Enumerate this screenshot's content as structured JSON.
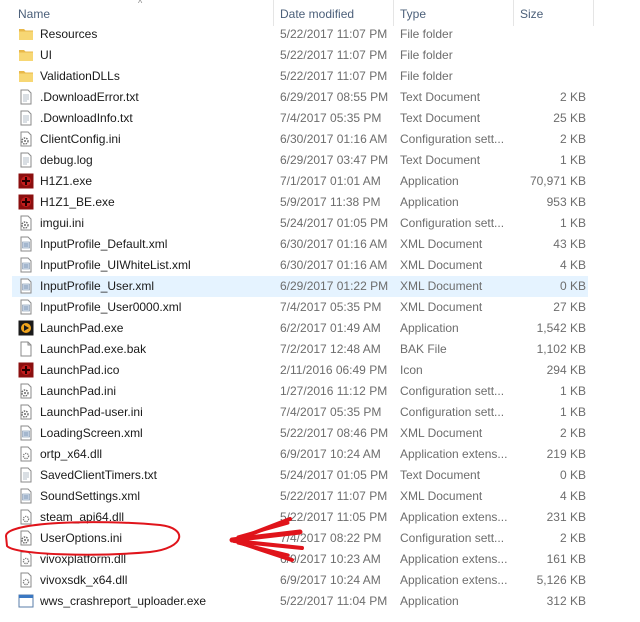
{
  "columns": {
    "name": "Name",
    "date_modified": "Date modified",
    "type": "Type",
    "size": "Size"
  },
  "sort_indicator": "^",
  "files": [
    {
      "name": "Resources",
      "date": "5/22/2017 11:07 PM",
      "type": "File folder",
      "size": "",
      "icon": "folder-icon"
    },
    {
      "name": "UI",
      "date": "5/22/2017 11:07 PM",
      "type": "File folder",
      "size": "",
      "icon": "folder-icon"
    },
    {
      "name": "ValidationDLLs",
      "date": "5/22/2017 11:07 PM",
      "type": "File folder",
      "size": "",
      "icon": "folder-icon"
    },
    {
      "name": ".DownloadError.txt",
      "date": "6/29/2017 08:55 PM",
      "type": "Text Document",
      "size": "2 KB",
      "icon": "text-file-icon"
    },
    {
      "name": ".DownloadInfo.txt",
      "date": "7/4/2017 05:35 PM",
      "type": "Text Document",
      "size": "25 KB",
      "icon": "text-file-icon"
    },
    {
      "name": "ClientConfig.ini",
      "date": "6/30/2017 01:16 AM",
      "type": "Configuration sett...",
      "size": "2 KB",
      "icon": "config-file-icon"
    },
    {
      "name": "debug.log",
      "date": "6/29/2017 03:47 PM",
      "type": "Text Document",
      "size": "1 KB",
      "icon": "text-file-icon"
    },
    {
      "name": "H1Z1.exe",
      "date": "7/1/2017 01:01 AM",
      "type": "Application",
      "size": "70,971 KB",
      "icon": "h1z1-app-icon"
    },
    {
      "name": "H1Z1_BE.exe",
      "date": "5/9/2017 11:38 PM",
      "type": "Application",
      "size": "953 KB",
      "icon": "h1z1-app-icon"
    },
    {
      "name": "imgui.ini",
      "date": "5/24/2017 01:05 PM",
      "type": "Configuration sett...",
      "size": "1 KB",
      "icon": "config-file-icon"
    },
    {
      "name": "InputProfile_Default.xml",
      "date": "6/30/2017 01:16 AM",
      "type": "XML Document",
      "size": "43 KB",
      "icon": "xml-file-icon"
    },
    {
      "name": "InputProfile_UIWhiteList.xml",
      "date": "6/30/2017 01:16 AM",
      "type": "XML Document",
      "size": "4 KB",
      "icon": "xml-file-icon"
    },
    {
      "name": "InputProfile_User.xml",
      "date": "6/29/2017 01:22 PM",
      "type": "XML Document",
      "size": "0 KB",
      "icon": "xml-file-icon",
      "selected": true
    },
    {
      "name": "InputProfile_User0000.xml",
      "date": "7/4/2017 05:35 PM",
      "type": "XML Document",
      "size": "27 KB",
      "icon": "xml-file-icon"
    },
    {
      "name": "LaunchPad.exe",
      "date": "6/2/2017 01:49 AM",
      "type": "Application",
      "size": "1,542 KB",
      "icon": "launchpad-app-icon"
    },
    {
      "name": "LaunchPad.exe.bak",
      "date": "7/2/2017 12:48 AM",
      "type": "BAK File",
      "size": "1,102 KB",
      "icon": "blank-file-icon"
    },
    {
      "name": "LaunchPad.ico",
      "date": "2/11/2016 06:49 PM",
      "type": "Icon",
      "size": "294 KB",
      "icon": "h1z1-app-icon"
    },
    {
      "name": "LaunchPad.ini",
      "date": "1/27/2016 11:12 PM",
      "type": "Configuration sett...",
      "size": "1 KB",
      "icon": "config-file-icon"
    },
    {
      "name": "LaunchPad-user.ini",
      "date": "7/4/2017 05:35 PM",
      "type": "Configuration sett...",
      "size": "1 KB",
      "icon": "config-file-icon"
    },
    {
      "name": "LoadingScreen.xml",
      "date": "5/22/2017 08:46 PM",
      "type": "XML Document",
      "size": "2 KB",
      "icon": "xml-file-icon"
    },
    {
      "name": "ortp_x64.dll",
      "date": "6/9/2017 10:24 AM",
      "type": "Application extens...",
      "size": "219 KB",
      "icon": "dll-file-icon"
    },
    {
      "name": "SavedClientTimers.txt",
      "date": "5/24/2017 01:05 PM",
      "type": "Text Document",
      "size": "0 KB",
      "icon": "text-file-icon"
    },
    {
      "name": "SoundSettings.xml",
      "date": "5/22/2017 11:07 PM",
      "type": "XML Document",
      "size": "4 KB",
      "icon": "xml-file-icon"
    },
    {
      "name": "steam_api64.dll",
      "date": "5/22/2017 11:05 PM",
      "type": "Application extens...",
      "size": "231 KB",
      "icon": "dll-file-icon"
    },
    {
      "name": "UserOptions.ini",
      "date": "7/4/2017 08:22 PM",
      "type": "Configuration sett...",
      "size": "2 KB",
      "icon": "config-file-icon",
      "annotated": true
    },
    {
      "name": "vivoxplatform.dll",
      "date": "6/9/2017 10:23 AM",
      "type": "Application extens...",
      "size": "161 KB",
      "icon": "dll-file-icon"
    },
    {
      "name": "vivoxsdk_x64.dll",
      "date": "6/9/2017 10:24 AM",
      "type": "Application extens...",
      "size": "5,126 KB",
      "icon": "dll-file-icon"
    },
    {
      "name": "wws_crashreport_uploader.exe",
      "date": "5/22/2017 11:04 PM",
      "type": "Application",
      "size": "312 KB",
      "icon": "exe-window-icon"
    }
  ],
  "colors": {
    "header_text": "#4c607a",
    "selected_row": "#e5f3ff",
    "annotation_red": "#e0141b",
    "folder_yellow": "#f7d774"
  }
}
